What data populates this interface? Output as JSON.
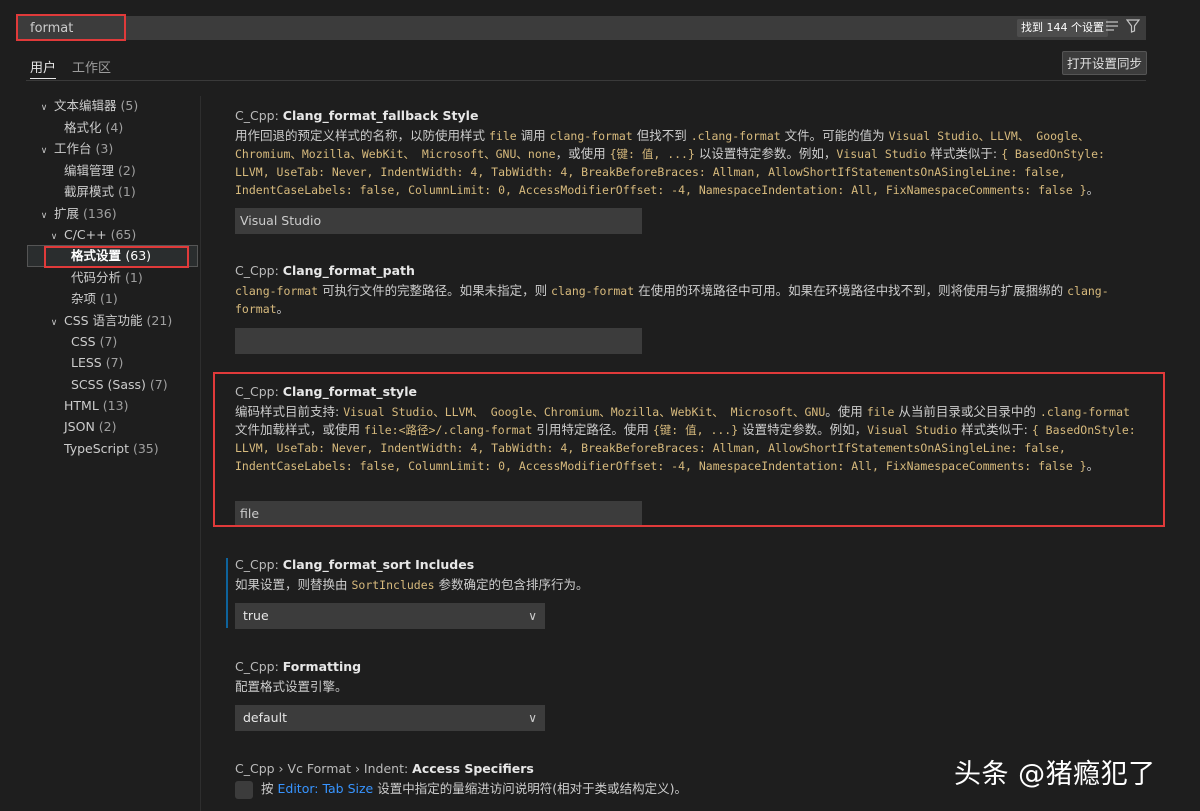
{
  "search": {
    "query": "format",
    "result_badge": "找到 144 个设置"
  },
  "tabs": [
    {
      "label": "用户"
    },
    {
      "label": "工作区"
    }
  ],
  "sync_button": "打开设置同步",
  "toc": [
    {
      "label": "文本编辑器",
      "count": "(5)"
    },
    {
      "label": "格式化",
      "count": "(4)"
    },
    {
      "label": "工作台",
      "count": "(3)"
    },
    {
      "label": "编辑管理",
      "count": "(2)"
    },
    {
      "label": "截屏模式",
      "count": "(1)"
    },
    {
      "label": "扩展",
      "count": "(136)"
    },
    {
      "label": "C/C++",
      "count": "(65)"
    },
    {
      "label": "格式设置",
      "count": "(63)"
    },
    {
      "label": "代码分析",
      "count": "(1)"
    },
    {
      "label": "杂项",
      "count": "(1)"
    },
    {
      "label": "CSS 语言功能",
      "count": "(21)"
    },
    {
      "label": "CSS",
      "count": "(7)"
    },
    {
      "label": "LESS",
      "count": "(7)"
    },
    {
      "label": "SCSS (Sass)",
      "count": "(7)"
    },
    {
      "label": "HTML",
      "count": "(13)"
    },
    {
      "label": "JSON",
      "count": "(2)"
    },
    {
      "label": "TypeScript",
      "count": "(35)"
    }
  ],
  "settings": {
    "fallback": {
      "cat": "C_Cpp: ",
      "name": "Clang_format_fallback Style",
      "d1": "用作回退的预定义样式的名称，以防使用样式 ",
      "c1": "file",
      "d2": " 调用 ",
      "c2": "clang-format",
      "d3": " 但找不到 ",
      "c3": ".clang-format",
      "d4": " 文件。可能的值为 ",
      "c4": "Visual Studio、LLVM、 Google、Chromium、Mozilla、WebKit、 Microsoft、GNU、none",
      "d5": "，或使用 ",
      "c5": "{键: 值, ...}",
      "d6": " 以设置特定参数。例如，",
      "c6": "Visual Studio",
      "d7": " 样式类似于: ",
      "c7": "{ BasedOnStyle: LLVM, UseTab: Never, IndentWidth: 4, TabWidth: 4, BreakBeforeBraces: Allman, AllowShortIfStatementsOnASingleLine: false, IndentCaseLabels: false, ColumnLimit: 0, AccessModifierOffset: -4, NamespaceIndentation: All, FixNamespaceComments: false }",
      "d8": "。",
      "value": "Visual Studio"
    },
    "path": {
      "cat": "C_Cpp: ",
      "name": "Clang_format_path",
      "c1": "clang-format",
      "d1": " 可执行文件的完整路径。如果未指定，则 ",
      "c2": "clang-format",
      "d2": " 在使用的环境路径中可用。如果在环境路径中找不到，则将使用与扩展捆绑的 ",
      "c3": "clang-format",
      "d3": "。",
      "value": ""
    },
    "style": {
      "cat": "C_Cpp: ",
      "name": "Clang_format_style",
      "d1": "编码样式目前支持: ",
      "c1": "Visual Studio、LLVM、 Google、Chromium、Mozilla、WebKit、 Microsoft、GNU",
      "d2": "。使用 ",
      "c2": "file",
      "d3": " 从当前目录或父目录中的 ",
      "c3": ".clang-format",
      "d4": " 文件加载样式，或使用 ",
      "c4": "file:<路径>/.clang-format",
      "d5": " 引用特定路径。使用 ",
      "c5": "{键: 值, ...}",
      "d6": " 设置特定参数。例如，",
      "c6": "Visual Studio",
      "d7": " 样式类似于: ",
      "c7": "{ BasedOnStyle: LLVM, UseTab: Never, IndentWidth: 4, TabWidth: 4, BreakBeforeBraces: Allman, AllowShortIfStatementsOnASingleLine: false, IndentCaseLabels: false, ColumnLimit: 0, AccessModifierOffset: -4, NamespaceIndentation: All, FixNamespaceComments: false }",
      "d8": "。",
      "value": "file"
    },
    "sort": {
      "cat": "C_Cpp: ",
      "name": "Clang_format_sort Includes",
      "d1": "如果设置，则替换由 ",
      "c1": "SortIncludes",
      "d2": " 参数确定的包含排序行为。",
      "value": "true"
    },
    "formatting": {
      "cat": "C_Cpp: ",
      "name": "Formatting",
      "d1": "配置格式设置引擎。",
      "value": "default"
    },
    "access": {
      "cat": "C_Cpp › Vc Format › Indent: ",
      "name": "Access Specifiers",
      "d1": "按 ",
      "link": "Editor: Tab Size",
      "d2": " 设置中指定的量缩进访问说明符(相对于类或结构定义)。"
    }
  },
  "watermark": "头条 @猪瘾犯了"
}
